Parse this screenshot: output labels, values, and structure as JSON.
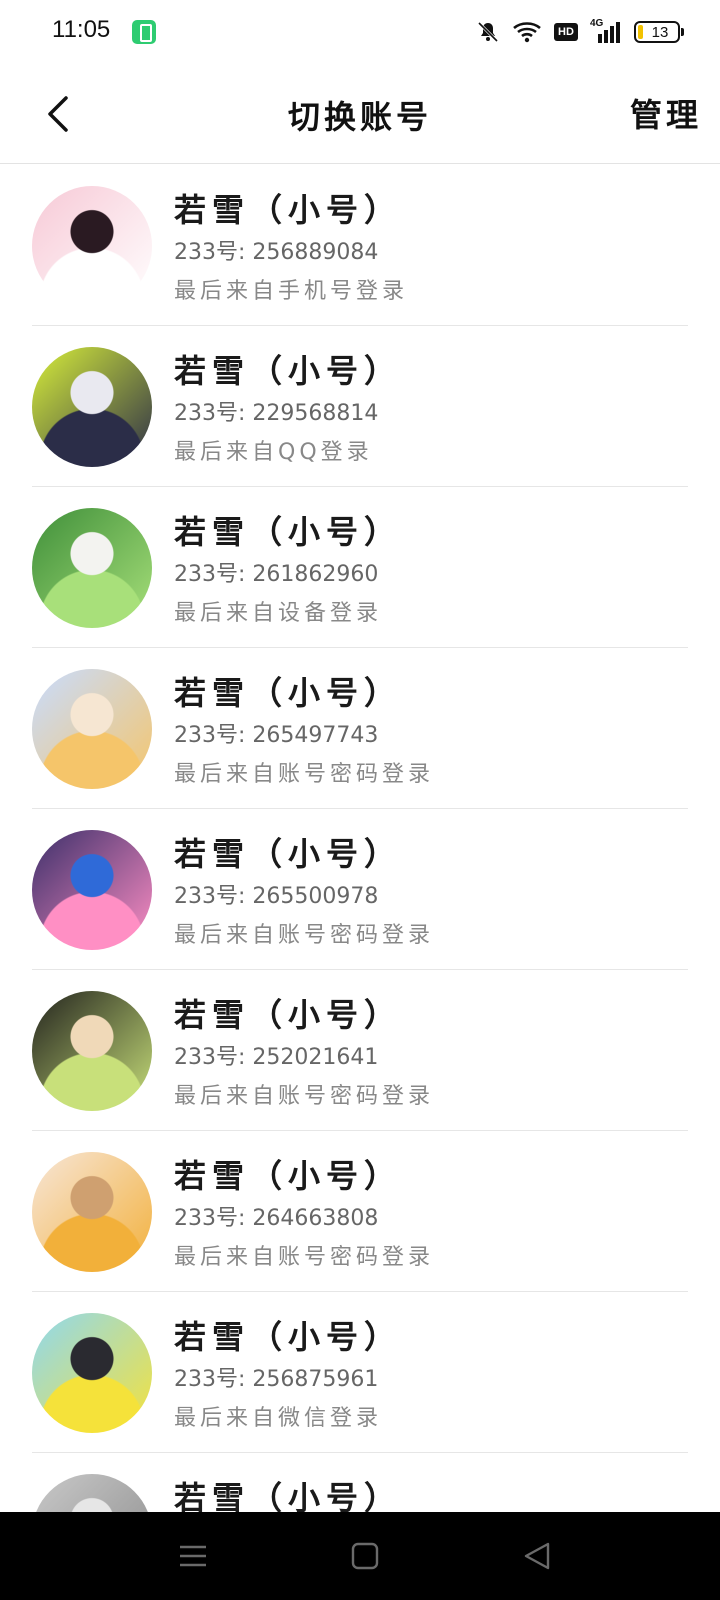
{
  "status_bar": {
    "time": "11:05",
    "battery_level": "13",
    "hd_label": "HD",
    "network_label": "4G"
  },
  "nav": {
    "title": "切换账号",
    "manage_label": "管理"
  },
  "accounts": [
    {
      "name": "若雪（小号）",
      "id_text": "233号: 256889084",
      "source": "最后来自手机号登录",
      "avatar_colors": [
        "#f7c9d6",
        "#ffffff",
        "#2a1a22"
      ]
    },
    {
      "name": "若雪（小号）",
      "id_text": "233号: 229568814",
      "source": "最后来自QQ登录",
      "avatar_colors": [
        "#d8ef3a",
        "#2b2d48",
        "#e9e9f0"
      ]
    },
    {
      "name": "若雪（小号）",
      "id_text": "233号: 261862960",
      "source": "最后来自设备登录",
      "avatar_colors": [
        "#3f8f3a",
        "#a8e07a",
        "#f3f3f0"
      ]
    },
    {
      "name": "若雪（小号）",
      "id_text": "233号: 265497743",
      "source": "最后来自账号密码登录",
      "avatar_colors": [
        "#c8dcff",
        "#f5c56a",
        "#f6e6d2"
      ]
    },
    {
      "name": "若雪（小号）",
      "id_text": "233号: 265500978",
      "source": "最后来自账号密码登录",
      "avatar_colors": [
        "#3b2f6a",
        "#ff8fc4",
        "#2f6ad8"
      ]
    },
    {
      "name": "若雪（小号）",
      "id_text": "233号: 252021641",
      "source": "最后来自账号密码登录",
      "avatar_colors": [
        "#23231e",
        "#c8e07a",
        "#f0d9b8"
      ]
    },
    {
      "name": "若雪（小号）",
      "id_text": "233号: 264663808",
      "source": "最后来自账号密码登录",
      "avatar_colors": [
        "#f7e6d8",
        "#f2b03a",
        "#cfa070"
      ]
    },
    {
      "name": "若雪（小号）",
      "id_text": "233号: 256875961",
      "source": "最后来自微信登录",
      "avatar_colors": [
        "#8fd8f0",
        "#f5e23a",
        "#2a2a30"
      ]
    },
    {
      "name": "若雪（小号）",
      "id_text": "",
      "source": "",
      "avatar_colors": [
        "#c9c9c9",
        "#8a8a8a",
        "#e6e6e6"
      ]
    }
  ]
}
